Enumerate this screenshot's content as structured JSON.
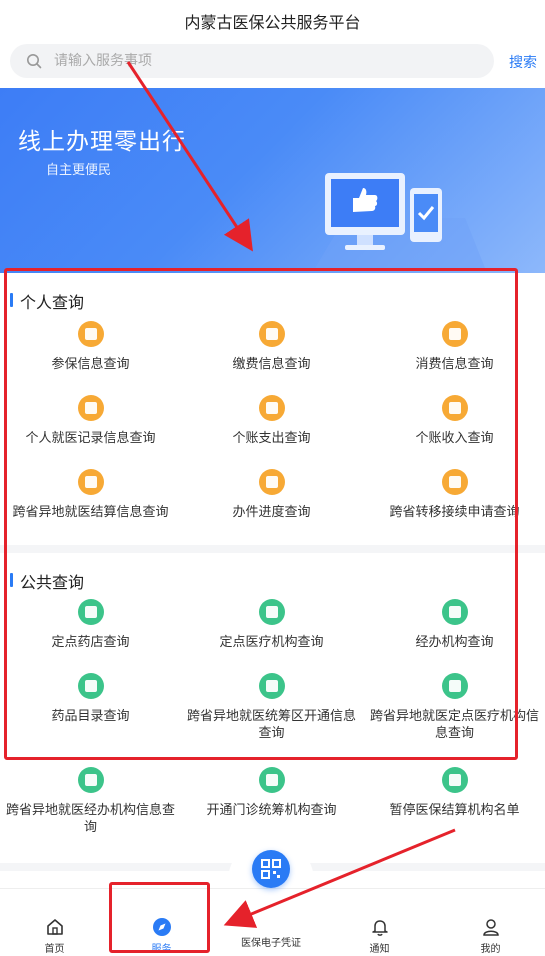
{
  "header": {
    "title": "内蒙古医保公共服务平台"
  },
  "search": {
    "placeholder": "请输入服务事项",
    "button": "搜索"
  },
  "banner": {
    "title": "线上办理零出行",
    "subtitle": "自主更便民"
  },
  "personal": {
    "title": "个人查询",
    "items": [
      {
        "label": "参保信息查询",
        "icon": "id-card-icon"
      },
      {
        "label": "缴费信息查询",
        "icon": "payment-icon"
      },
      {
        "label": "消费信息查询",
        "icon": "receipt-icon"
      },
      {
        "label": "个人就医记录信息查询",
        "icon": "medical-kit-icon"
      },
      {
        "label": "个账支出查询",
        "icon": "wallet-out-icon"
      },
      {
        "label": "个账收入查询",
        "icon": "wallet-in-icon"
      },
      {
        "label": "跨省异地就医结算信息查询",
        "icon": "house-icon"
      },
      {
        "label": "办件进度查询",
        "icon": "progress-icon"
      },
      {
        "label": "跨省转移接续申请查询",
        "icon": "transfer-icon"
      }
    ]
  },
  "public": {
    "title": "公共查询",
    "items": [
      {
        "label": "定点药店查询",
        "icon": "store-icon"
      },
      {
        "label": "定点医疗机构查询",
        "icon": "hospital-doc-icon"
      },
      {
        "label": "经办机构查询",
        "icon": "bank-icon"
      },
      {
        "label": "药品目录查询",
        "icon": "drug-doc-icon"
      },
      {
        "label": "跨省异地就医统筹区开通信息查询",
        "icon": "region-doc-icon"
      },
      {
        "label": "跨省异地就医定点医疗机构信息查询",
        "icon": "medical-cross-icon"
      },
      {
        "label": "跨省异地就医经办机构信息查询",
        "icon": "agency-icon"
      },
      {
        "label": "开通门诊统筹机构查询",
        "icon": "clinic-doc-icon"
      },
      {
        "label": "暂停医保结算机构名单",
        "icon": "pause-icon"
      }
    ]
  },
  "tabbar": {
    "home": "首页",
    "service": "服务",
    "voucher": "医保电子凭证",
    "notice": "通知",
    "mine": "我的"
  },
  "colors": {
    "accent": "#2a7bf5",
    "orange": "#f7a935",
    "green": "#3cc48a",
    "annotation": "#e5222b"
  }
}
